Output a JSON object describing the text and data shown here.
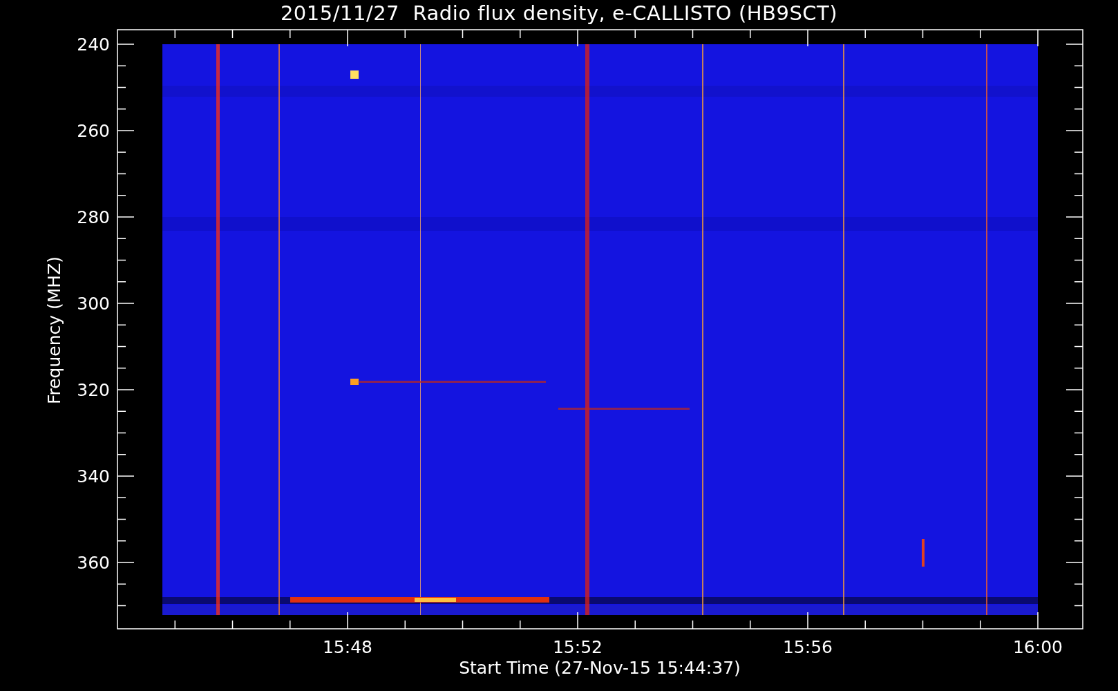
{
  "title": "2015/11/27  Radio flux density, e-CALLISTO (HB9SCT)",
  "y_axis": {
    "label": "Frequency (MHZ)",
    "ticks": [
      "240",
      "260",
      "280",
      "300",
      "320",
      "340",
      "360"
    ]
  },
  "x_axis": {
    "label": "Start Time (27-Nov-15 15:44:37)",
    "ticks": [
      "15:48",
      "15:52",
      "15:56",
      "16:00"
    ]
  }
}
